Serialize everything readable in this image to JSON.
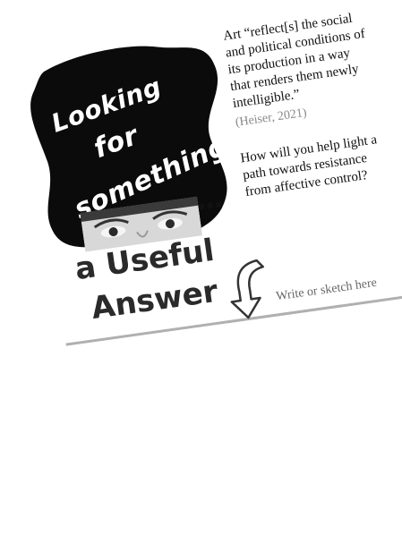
{
  "poster": {
    "blob_text": {
      "line1": "Looking",
      "line2": "for",
      "line3": "something?"
    },
    "ellipsis": "...",
    "headline": {
      "line1": "a Useful",
      "line2": "Answer"
    },
    "quote": "Art “reflect[s] the social and political conditions of its production in a way that renders them newly intelligible.”",
    "citation": "(Heiser, 2021)",
    "question": "How will you help light a path towards resistance from affective control?",
    "prompt": "Write or sketch here"
  },
  "icons": {
    "arrow": "curved-down-arrow-icon"
  },
  "colors": {
    "blob": "#0b0b0b",
    "rule": "#b0b0b0",
    "headline": "#2a2a2a",
    "citation": "#888888"
  }
}
